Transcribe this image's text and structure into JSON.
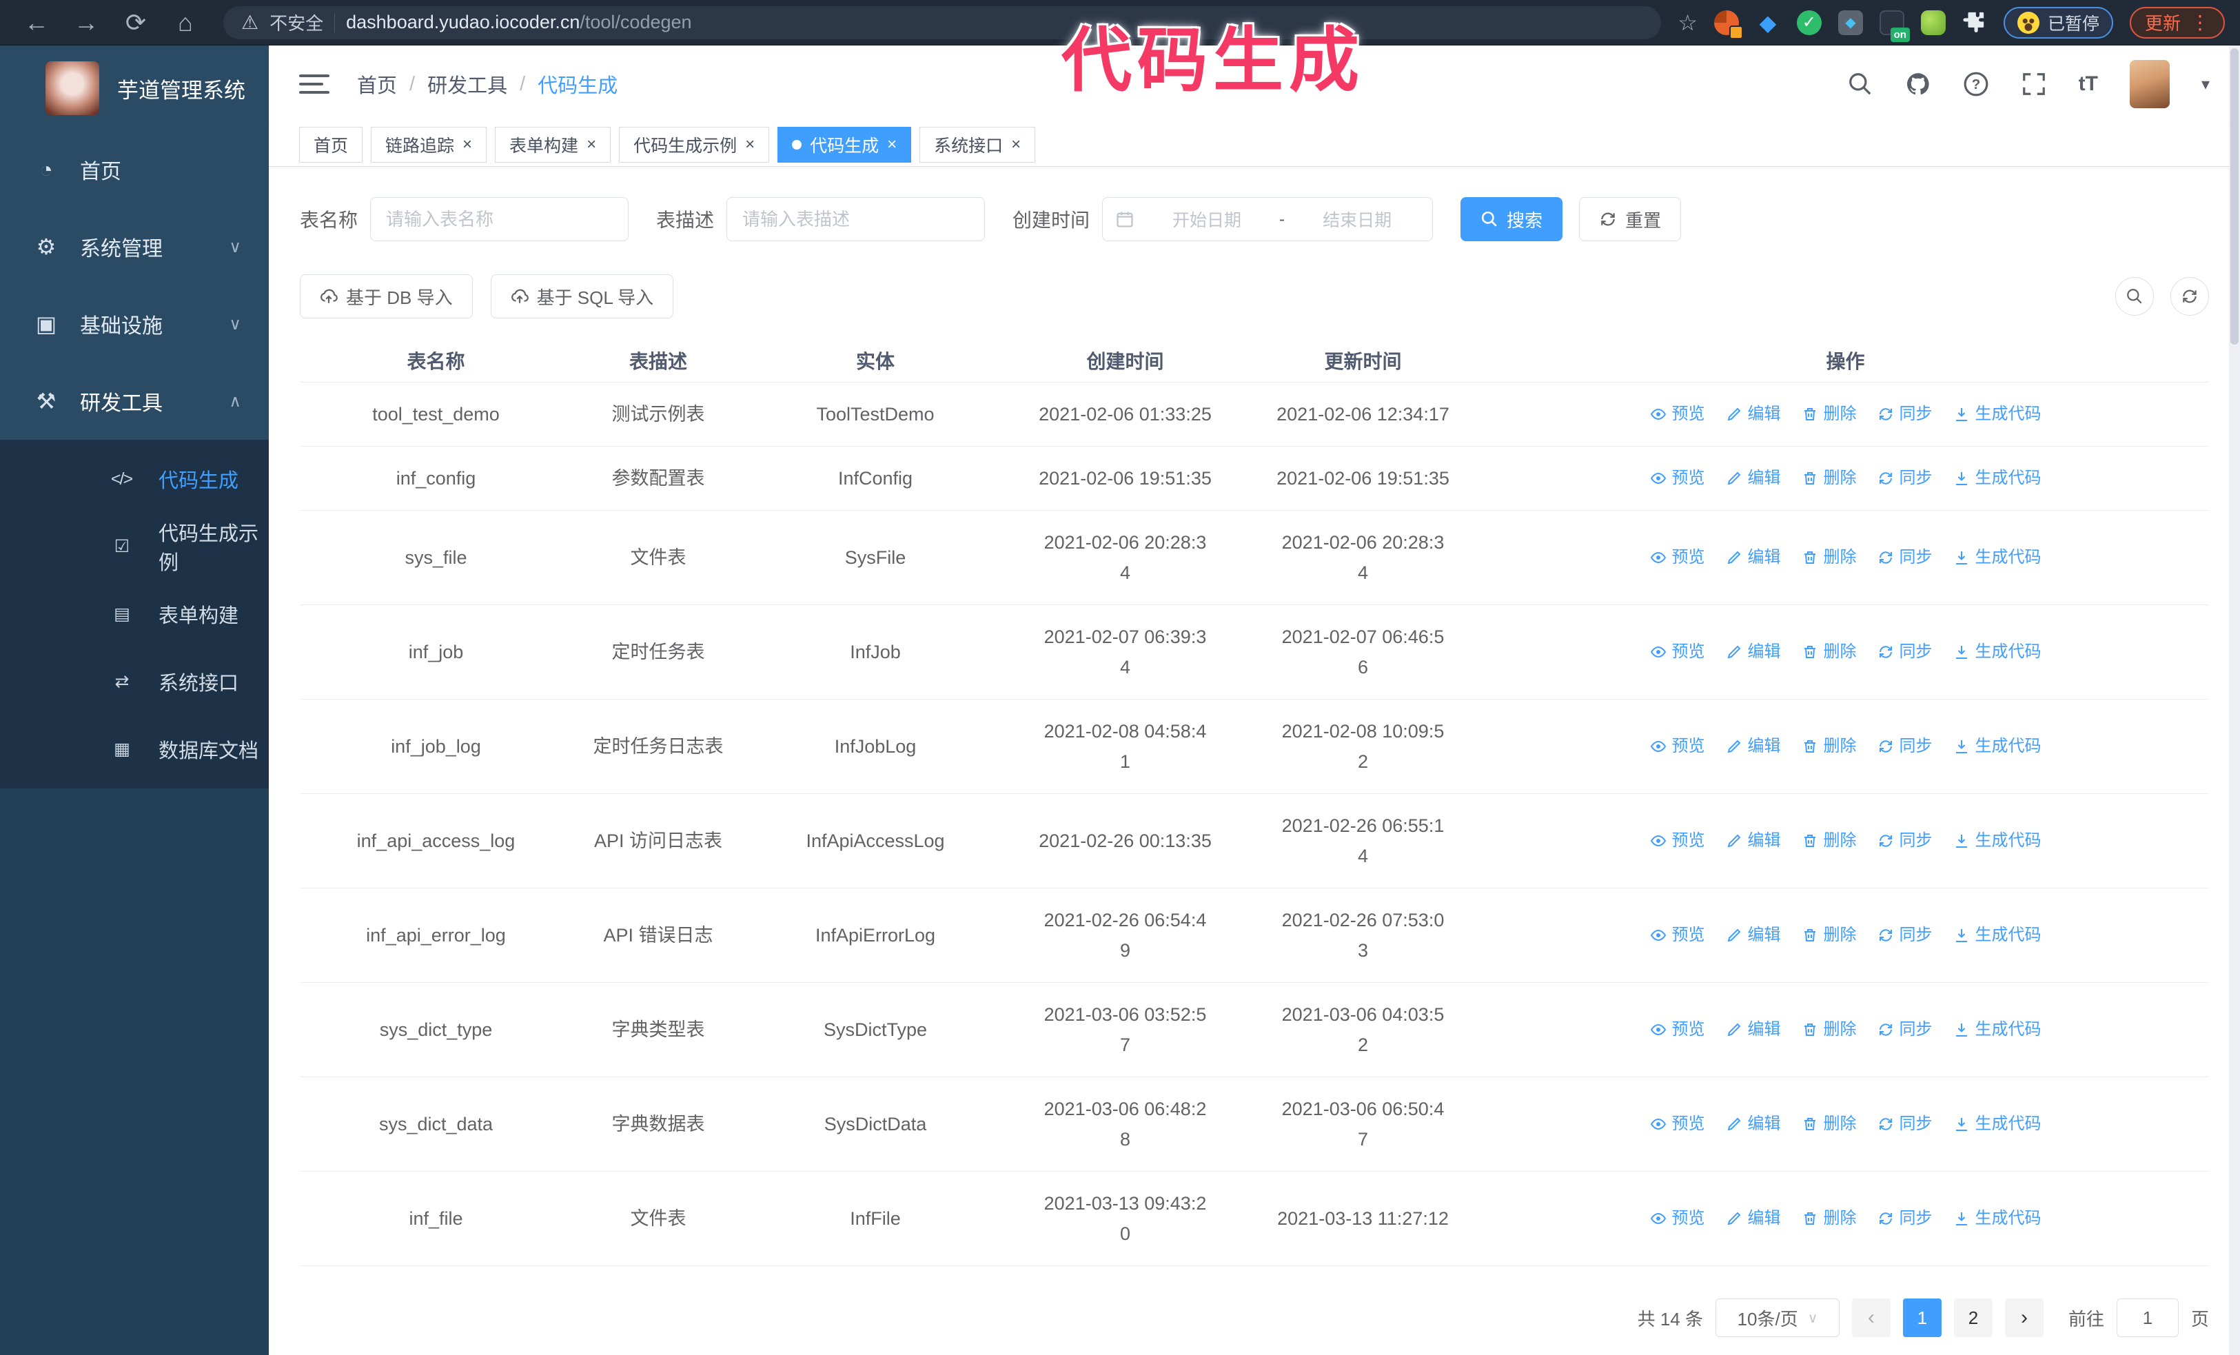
{
  "browser": {
    "security_label": "不安全",
    "url_host": "dashboard.yudao.iocoder.cn",
    "url_path": "/tool/codegen",
    "ext_on_badge": "on",
    "paused_label": "已暂停",
    "update_label": "更新"
  },
  "annotation": {
    "text": "代码生成"
  },
  "icons": {
    "back": "←",
    "forward": "→",
    "reload": "⟳",
    "home": "⌂",
    "warning": "⚠",
    "star": "☆",
    "kebab": "⋮",
    "close": "×",
    "caret_down": "▾",
    "select_caret": "∨",
    "pager_prev": "‹",
    "pager_next": "›",
    "blue_gem": "◆",
    "green_check": "✓"
  },
  "sidebar": {
    "title": "芋道管理系统",
    "items": [
      {
        "label": "首页",
        "icon": "◔",
        "chevron": "",
        "active": false
      },
      {
        "label": "系统管理",
        "icon": "⚙",
        "chevron": "∨",
        "active": false
      },
      {
        "label": "基础设施",
        "icon": "▣",
        "chevron": "∨",
        "active": false
      },
      {
        "label": "研发工具",
        "icon": "⚒",
        "chevron": "∧",
        "active": true
      }
    ],
    "submenu": [
      {
        "label": "代码生成",
        "icon": "</>",
        "active": true
      },
      {
        "label": "代码生成示例",
        "icon": "☑",
        "active": false
      },
      {
        "label": "表单构建",
        "icon": "▤",
        "active": false
      },
      {
        "label": "系统接口",
        "icon": "⇄",
        "active": false
      },
      {
        "label": "数据库文档",
        "icon": "▦",
        "active": false
      }
    ]
  },
  "breadcrumb": {
    "separator": "/",
    "items": [
      "首页",
      "研发工具",
      "代码生成"
    ]
  },
  "tabs": [
    {
      "label": "首页",
      "closable": false,
      "active": false
    },
    {
      "label": "链路追踪",
      "closable": true,
      "active": false
    },
    {
      "label": "表单构建",
      "closable": true,
      "active": false
    },
    {
      "label": "代码生成示例",
      "closable": true,
      "active": false
    },
    {
      "label": "代码生成",
      "closable": true,
      "active": true
    },
    {
      "label": "系统接口",
      "closable": true,
      "active": false
    }
  ],
  "filters": {
    "name_label": "表名称",
    "name_placeholder": "请输入表名称",
    "desc_label": "表描述",
    "desc_placeholder": "请输入表描述",
    "time_label": "创建时间",
    "start_placeholder": "开始日期",
    "range_separator": "-",
    "end_placeholder": "结束日期",
    "search_label": "搜索",
    "reset_label": "重置"
  },
  "toolbar": {
    "db_import_label": "基于 DB 导入",
    "sql_import_label": "基于 SQL 导入"
  },
  "table": {
    "columns": [
      "表名称",
      "表描述",
      "实体",
      "创建时间",
      "更新时间",
      "操作"
    ],
    "actions": [
      "预览",
      "编辑",
      "删除",
      "同步",
      "生成代码"
    ],
    "rows": [
      {
        "name": "tool_test_demo",
        "desc": "测试示例表",
        "entity": "ToolTestDemo",
        "created": "2021-02-06 01:33:25",
        "updated": "2021-02-06 12:34:17"
      },
      {
        "name": "inf_config",
        "desc": "参数配置表",
        "entity": "InfConfig",
        "created": "2021-02-06 19:51:35",
        "updated": "2021-02-06 19:51:35"
      },
      {
        "name": "sys_file",
        "desc": "文件表",
        "entity": "SysFile",
        "created": "2021-02-06 20:28:3\n4",
        "updated": "2021-02-06 20:28:3\n4"
      },
      {
        "name": "inf_job",
        "desc": "定时任务表",
        "entity": "InfJob",
        "created": "2021-02-07 06:39:3\n4",
        "updated": "2021-02-07 06:46:5\n6"
      },
      {
        "name": "inf_job_log",
        "desc": "定时任务日志表",
        "entity": "InfJobLog",
        "created": "2021-02-08 04:58:4\n1",
        "updated": "2021-02-08 10:09:5\n2"
      },
      {
        "name": "inf_api_access_log",
        "desc": "API 访问日志表",
        "entity": "InfApiAccessLog",
        "created": "2021-02-26 00:13:35",
        "updated": "2021-02-26 06:55:1\n4"
      },
      {
        "name": "inf_api_error_log",
        "desc": "API 错误日志",
        "entity": "InfApiErrorLog",
        "created": "2021-02-26 06:54:4\n9",
        "updated": "2021-02-26 07:53:0\n3"
      },
      {
        "name": "sys_dict_type",
        "desc": "字典类型表",
        "entity": "SysDictType",
        "created": "2021-03-06 03:52:5\n7",
        "updated": "2021-03-06 04:03:5\n2"
      },
      {
        "name": "sys_dict_data",
        "desc": "字典数据表",
        "entity": "SysDictData",
        "created": "2021-03-06 06:48:2\n8",
        "updated": "2021-03-06 06:50:4\n7"
      },
      {
        "name": "inf_file",
        "desc": "文件表",
        "entity": "InfFile",
        "created": "2021-03-13 09:43:2\n0",
        "updated": "2021-03-13 11:27:12"
      }
    ]
  },
  "pagination": {
    "total": "共 14 条",
    "page_size": "10条/页",
    "pages": [
      {
        "label": "1",
        "active": true
      },
      {
        "label": "2",
        "active": false
      }
    ],
    "goto_label": "前往",
    "goto_value": "1",
    "goto_suffix": "页"
  }
}
